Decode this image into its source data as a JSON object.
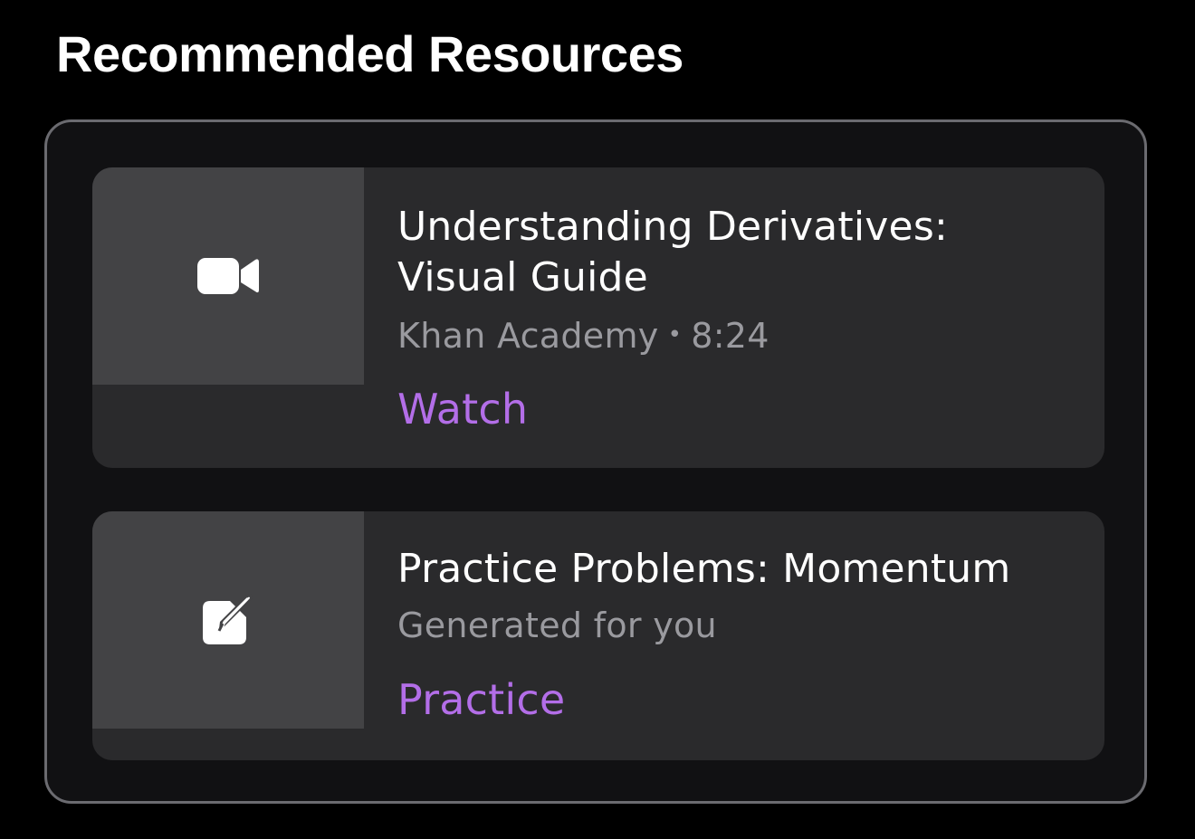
{
  "section": {
    "title": "Recommended Resources"
  },
  "resources": [
    {
      "icon": "video-camera-icon",
      "title_line1": "Understanding Derivatives:",
      "title_line2": "Visual Guide",
      "source": "Khan Academy",
      "separator": "•",
      "duration": "8:24",
      "action_label": "Watch"
    },
    {
      "icon": "square-pencil-icon",
      "title_line1": "Practice Problems: Momentum",
      "subtitle": "Generated for you",
      "action_label": "Practice"
    }
  ],
  "colors": {
    "background": "#000000",
    "panel": "#111113",
    "panel_border": "#6b6b70",
    "card": "#2a2a2c",
    "thumbnail": "#434345",
    "meta_text": "#9a9a9f",
    "accent": "#b36ee8"
  }
}
